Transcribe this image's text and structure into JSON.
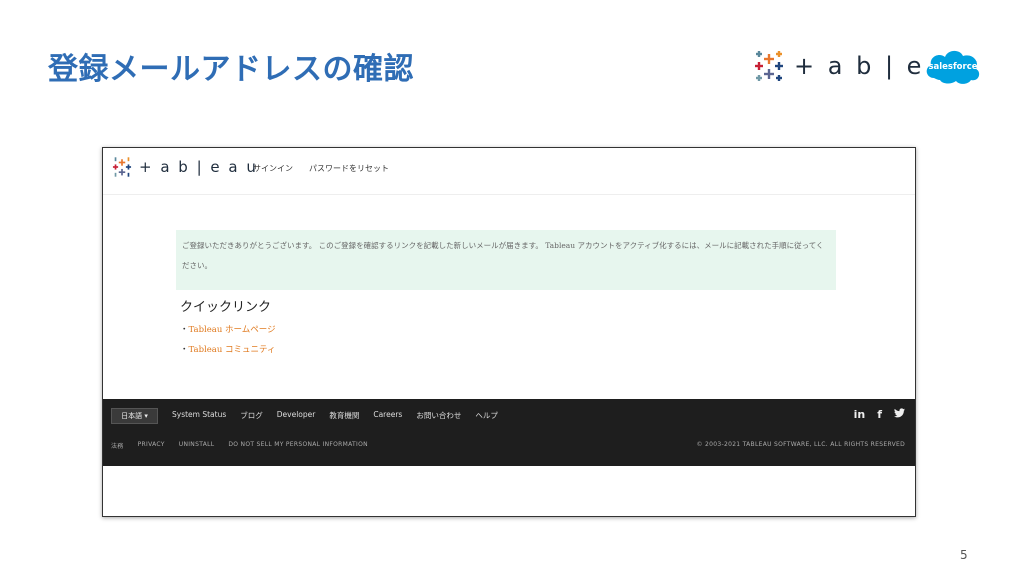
{
  "slide": {
    "title": "登録メールアドレスの確認",
    "page_number": "5",
    "brand_wordmark": "+ a b | e a u",
    "salesforce_label": "salesforce"
  },
  "site": {
    "logo_text": "+ a b | e a u",
    "nav": [
      "サインイン",
      "パスワードをリセット"
    ],
    "notice_text": "ご登録いただきありがとうございます。 このご登録を確認するリンクを記載した新しいメールが届きます。 Tableau アカウントをアクティブ化するには、メールに記載された手順に従ってください。",
    "quick_links_title": "クイックリンク",
    "quick_links": [
      {
        "label": "Tableau ホームページ"
      },
      {
        "label": "Tableau コミュニティ"
      }
    ]
  },
  "footer": {
    "language": "日本語 ▾",
    "nav": [
      "System Status",
      "ブログ",
      "Developer",
      "教育機関",
      "Careers",
      "お問い合わせ",
      "ヘルプ"
    ],
    "legal": [
      "法務",
      "PRIVACY",
      "UNINSTALL",
      "DO NOT SELL MY PERSONAL INFORMATION"
    ],
    "copyright": "© 2003-2021 TABLEAU SOFTWARE, LLC. ALL RIGHTS RESERVED",
    "social": {
      "linkedin": "in",
      "facebook": "f",
      "twitter": "t"
    }
  },
  "colors": {
    "title_blue": "#2f6db5",
    "notice_bg": "#e7f6ee",
    "link_orange": "#e07a1f",
    "footer_bg": "#1e1e1e",
    "salesforce_blue": "#00a1e0"
  }
}
